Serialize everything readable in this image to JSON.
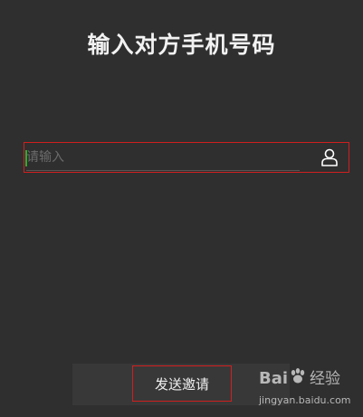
{
  "page": {
    "title": "输入对方手机号码"
  },
  "phone_input": {
    "placeholder": "请输入",
    "value": ""
  },
  "contact_icon": "contact-person-icon",
  "send_button": {
    "label": "发送邀请"
  },
  "watermark": {
    "brand": "Baidu经验",
    "url": "jingyan.baidu.com"
  },
  "colors": {
    "background": "#2f2f2f",
    "highlight": "#d01f1f",
    "caret": "#2fae2f"
  }
}
